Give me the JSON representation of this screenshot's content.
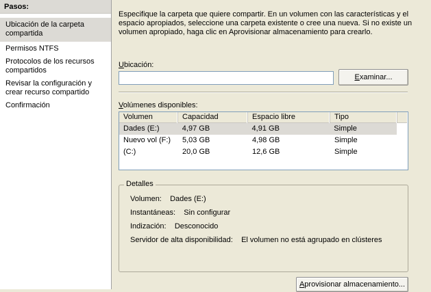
{
  "steps": {
    "header": "Pasos:",
    "items": [
      {
        "label": "Ubicación de la carpeta compartida",
        "active": true
      },
      {
        "label": "Permisos NTFS",
        "active": false
      },
      {
        "label": "Protocolos de los recursos compartidos",
        "active": false
      },
      {
        "label": "Revisar la configuración y crear recurso compartido",
        "active": false
      },
      {
        "label": "Confirmación",
        "active": false
      }
    ]
  },
  "main": {
    "description": "Especifique la carpeta que quiere compartir. En un volumen con las características y el espacio apropiados, seleccione una carpeta existente o cree una nueva. Si no existe un volumen apropiado, haga clic en Aprovisionar almacenamiento para crearlo.",
    "location_label_underlined": "U",
    "location_label_rest": "bicación:",
    "location_value": "",
    "browse_button_underlined": "E",
    "browse_button_rest": "xaminar...",
    "volumes_label_underlined": "V",
    "volumes_label_rest": "olúmenes disponibles:",
    "volumes_table": {
      "headers": [
        "Volumen",
        "Capacidad",
        "Espacio libre",
        "Tipo"
      ],
      "rows": [
        [
          "Dades (E:)",
          "4,97 GB",
          "4,91 GB",
          "Simple"
        ],
        [
          "Nuevo vol (F:)",
          "5,03 GB",
          "4,98 GB",
          "Simple"
        ],
        [
          "(C:)",
          "20,0 GB",
          "12,6 GB",
          "Simple"
        ]
      ]
    },
    "details": {
      "legend": "Detalles",
      "volume_key": "Volumen:",
      "volume_val": "Dades (E:)",
      "snapshots_key": "Instantáneas:",
      "snapshots_val": "Sin configurar",
      "indexing_key": "Indización:",
      "indexing_val": "Desconocido",
      "ha_key": "Servidor de alta disponibilidad:",
      "ha_val": "El volumen no está agrupado en clústeres"
    },
    "provision_button_underlined": "A",
    "provision_button_rest": "provisionar almacenamiento..."
  }
}
